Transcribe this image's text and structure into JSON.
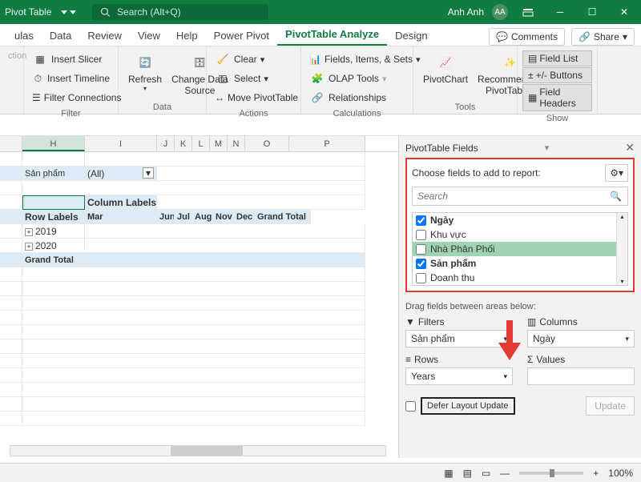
{
  "titlebar": {
    "pivot_label": "Pivot Table",
    "search_placeholder": "Search (Alt+Q)",
    "user": "Anh Anh",
    "avatar": "AA"
  },
  "tabs": {
    "items": [
      "ulas",
      "Data",
      "Review",
      "View",
      "Help",
      "Power Pivot",
      "PivotTable Analyze",
      "Design"
    ],
    "active": 6,
    "comments": "Comments",
    "share": "Share"
  },
  "ribbon": {
    "pivot": {
      "ction": "ction"
    },
    "filter": {
      "slicer": "Insert Slicer",
      "timeline": "Insert Timeline",
      "connections": "Filter Connections",
      "label": "Filter"
    },
    "data": {
      "refresh": "Refresh",
      "change": "Change Data\nSource",
      "label": "Data"
    },
    "actions": {
      "clear": "Clear",
      "select": "Select",
      "move": "Move PivotTable",
      "label": "Actions"
    },
    "calc": {
      "fields": "Fields, Items, & Sets",
      "olap": "OLAP Tools",
      "rel": "Relationships",
      "label": "Calculations"
    },
    "tools": {
      "chart": "PivotChart",
      "rec": "Recommended\nPivotTables",
      "label": "Tools"
    },
    "show": {
      "list": "Field List",
      "btns": "+/- Buttons",
      "hdrs": "Field Headers",
      "label": "Show"
    }
  },
  "grid": {
    "cols": [
      "H",
      "I",
      "J",
      "K",
      "L",
      "M",
      "N",
      "O",
      "P"
    ],
    "filter_label": "Sản phẩm",
    "filter_val": "(All)",
    "col_labels": "Column Labels",
    "row_labels": "Row Labels",
    "mar": "Mar",
    "months": [
      "Jun",
      "Jul",
      "Aug",
      "Nov",
      "Dec"
    ],
    "grand": "Grand Total",
    "y1": "2019",
    "y2": "2020",
    "gt": "Grand Total"
  },
  "pane": {
    "title": "PivotTable Fields",
    "choose": "Choose fields to add to report:",
    "search": "Search",
    "fields": [
      {
        "label": "Ngày",
        "checked": true
      },
      {
        "label": "Khu vực",
        "checked": false
      },
      {
        "label": "Nhà Phân Phối",
        "checked": false,
        "hover": true
      },
      {
        "label": "Sản phẩm",
        "checked": true
      },
      {
        "label": "Doanh thu",
        "checked": false
      }
    ],
    "drag": "Drag fields between areas below:",
    "filters": "Filters",
    "columns": "Columns",
    "rows": "Rows",
    "values": "Values",
    "filter_item": "Sản phẩm",
    "col_item": "Ngày",
    "row_item": "Years",
    "defer": "Defer Layout Update",
    "update": "Update"
  },
  "status": {
    "zoom": "100%"
  }
}
